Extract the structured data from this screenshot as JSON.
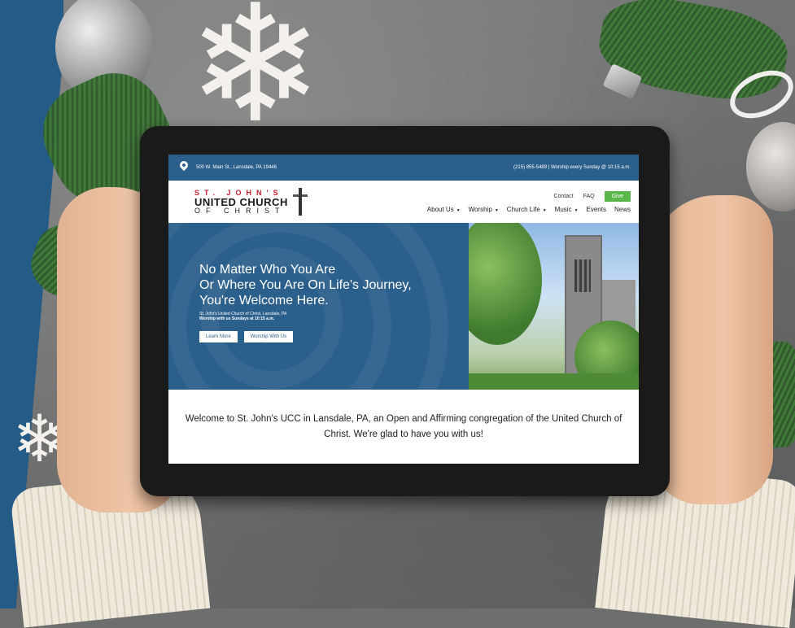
{
  "site": {
    "topbar": {
      "address": "500 W. Main St., Lansdale, PA 19446",
      "contact_line": "(215) 855-5489 | Worship every Sunday @ 10:15 a.m."
    },
    "logo": {
      "line1": "ST. JOHN'S",
      "line2": "UNITED CHURCH",
      "line3": "OF CHRIST"
    },
    "utility_nav": {
      "contact": "Contact",
      "faq": "FAQ",
      "give": "Give"
    },
    "main_nav": [
      {
        "label": "About Us"
      },
      {
        "label": "Worship"
      },
      {
        "label": "Church Life"
      },
      {
        "label": "Music"
      },
      {
        "label": "Events"
      },
      {
        "label": "News"
      }
    ],
    "hero": {
      "headline_1": "No Matter Who You Are",
      "headline_2": "Or Where You Are On Life's Journey,",
      "headline_3": "You're Welcome Here.",
      "sub_1": "St. John's United Church of Christ, Lansdale, PA",
      "sub_2": "Worship with us Sundays at 10:15 a.m.",
      "btn_learn": "Learn More",
      "btn_worship": "Worship With Us"
    },
    "welcome": "Welcome to St. John's UCC in Lansdale, PA, an Open and Affirming congregation of the United Church of Christ. We're glad to have you with us!"
  },
  "colors": {
    "brand_blue": "#2b5f8c",
    "give_green": "#5ab54b",
    "logo_red": "#c3202e"
  },
  "icons": [
    "location-pin-icon",
    "caret-down-icon"
  ]
}
